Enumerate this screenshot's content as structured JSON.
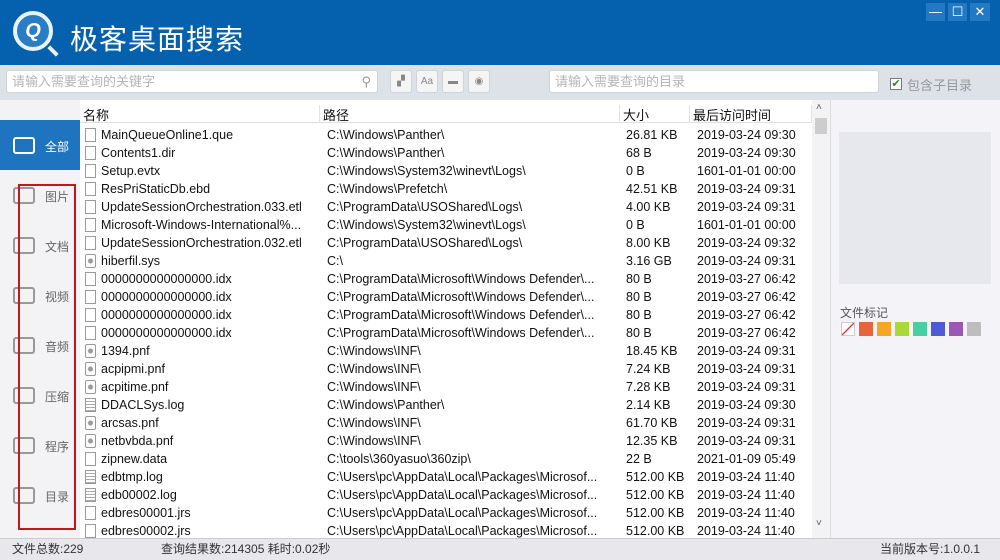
{
  "app": {
    "title": "极客桌面搜索",
    "logo_letter": "Q"
  },
  "window_controls": {
    "minimize": "—",
    "maximize": "☐",
    "close": "✕"
  },
  "toolbar": {
    "keyword_placeholder": "请输入需要查询的关键字",
    "dir_placeholder": "请输入需要查询的目录",
    "include_subdirs_label": "包含子目录",
    "include_subdirs_checked": true,
    "case_label": "Aa"
  },
  "sidebar": {
    "items": [
      {
        "label": "全部",
        "active": true
      },
      {
        "label": "图片"
      },
      {
        "label": "文档"
      },
      {
        "label": "视频"
      },
      {
        "label": "音频"
      },
      {
        "label": "压缩"
      },
      {
        "label": "程序"
      },
      {
        "label": "目录"
      }
    ]
  },
  "table": {
    "columns": [
      "名称",
      "路径",
      "大小",
      "最后访问时间"
    ],
    "rows": [
      {
        "name": "MainQueueOnline1.que",
        "path": "C:\\Windows\\Panther\\",
        "size": "26.81 KB",
        "time": "2019-03-24 09:30",
        "icon": "file"
      },
      {
        "name": "Contents1.dir",
        "path": "C:\\Windows\\Panther\\",
        "size": "68 B",
        "time": "2019-03-24 09:30",
        "icon": "file"
      },
      {
        "name": "Setup.evtx",
        "path": "C:\\Windows\\System32\\winevt\\Logs\\",
        "size": "0 B",
        "time": "1601-01-01 00:00",
        "icon": "file"
      },
      {
        "name": "ResPriStaticDb.ebd",
        "path": "C:\\Windows\\Prefetch\\",
        "size": "42.51 KB",
        "time": "2019-03-24 09:31",
        "icon": "file"
      },
      {
        "name": "UpdateSessionOrchestration.033.etl",
        "path": "C:\\ProgramData\\USOShared\\Logs\\",
        "size": "4.00 KB",
        "time": "2019-03-24 09:31",
        "icon": "file"
      },
      {
        "name": "Microsoft-Windows-International%...",
        "path": "C:\\Windows\\System32\\winevt\\Logs\\",
        "size": "0 B",
        "time": "1601-01-01 00:00",
        "icon": "file"
      },
      {
        "name": "UpdateSessionOrchestration.032.etl",
        "path": "C:\\ProgramData\\USOShared\\Logs\\",
        "size": "8.00 KB",
        "time": "2019-03-24 09:32",
        "icon": "file"
      },
      {
        "name": "hiberfil.sys",
        "path": "C:\\",
        "size": "3.16 GB",
        "time": "2019-03-24 09:31",
        "icon": "gear"
      },
      {
        "name": "0000000000000000.idx",
        "path": "C:\\ProgramData\\Microsoft\\Windows Defender\\...",
        "size": "80 B",
        "time": "2019-03-27 06:42",
        "icon": "file"
      },
      {
        "name": "0000000000000000.idx",
        "path": "C:\\ProgramData\\Microsoft\\Windows Defender\\...",
        "size": "80 B",
        "time": "2019-03-27 06:42",
        "icon": "file"
      },
      {
        "name": "0000000000000000.idx",
        "path": "C:\\ProgramData\\Microsoft\\Windows Defender\\...",
        "size": "80 B",
        "time": "2019-03-27 06:42",
        "icon": "file"
      },
      {
        "name": "0000000000000000.idx",
        "path": "C:\\ProgramData\\Microsoft\\Windows Defender\\...",
        "size": "80 B",
        "time": "2019-03-27 06:42",
        "icon": "file"
      },
      {
        "name": "1394.pnf",
        "path": "C:\\Windows\\INF\\",
        "size": "18.45 KB",
        "time": "2019-03-24 09:31",
        "icon": "gear"
      },
      {
        "name": "acpipmi.pnf",
        "path": "C:\\Windows\\INF\\",
        "size": "7.24 KB",
        "time": "2019-03-24 09:31",
        "icon": "gear"
      },
      {
        "name": "acpitime.pnf",
        "path": "C:\\Windows\\INF\\",
        "size": "7.28 KB",
        "time": "2019-03-24 09:31",
        "icon": "gear"
      },
      {
        "name": "DDACLSys.log",
        "path": "C:\\Windows\\Panther\\",
        "size": "2.14 KB",
        "time": "2019-03-24 09:30",
        "icon": "log"
      },
      {
        "name": "arcsas.pnf",
        "path": "C:\\Windows\\INF\\",
        "size": "61.70 KB",
        "time": "2019-03-24 09:31",
        "icon": "gear"
      },
      {
        "name": "netbvbda.pnf",
        "path": "C:\\Windows\\INF\\",
        "size": "12.35 KB",
        "time": "2019-03-24 09:31",
        "icon": "gear"
      },
      {
        "name": "zipnew.data",
        "path": "C:\\tools\\360yasuo\\360zip\\",
        "size": "22 B",
        "time": "2021-01-09 05:49",
        "icon": "file"
      },
      {
        "name": "edbtmp.log",
        "path": "C:\\Users\\pc\\AppData\\Local\\Packages\\Microsof...",
        "size": "512.00 KB",
        "time": "2019-03-24 11:40",
        "icon": "log"
      },
      {
        "name": "edb00002.log",
        "path": "C:\\Users\\pc\\AppData\\Local\\Packages\\Microsof...",
        "size": "512.00 KB",
        "time": "2019-03-24 11:40",
        "icon": "log"
      },
      {
        "name": "edbres00001.jrs",
        "path": "C:\\Users\\pc\\AppData\\Local\\Packages\\Microsof...",
        "size": "512.00 KB",
        "time": "2019-03-24 11:40",
        "icon": "file"
      },
      {
        "name": "edbres00002.jrs",
        "path": "C:\\Users\\pc\\AppData\\Local\\Packages\\Microsof...",
        "size": "512.00 KB",
        "time": "2019-03-24 11:40",
        "icon": "file"
      }
    ]
  },
  "right_panel": {
    "mark_label": "文件标记",
    "mark_colors": [
      "none",
      "#e8643c",
      "#f5a623",
      "#a8d83a",
      "#48cfa0",
      "#4f5bd5",
      "#9b59b6",
      "#bdbdbd"
    ]
  },
  "status": {
    "total_files": "文件总数:229",
    "result": "查询结果数:214305 耗时:0.02秒",
    "version": "当前版本号:1.0.0.1"
  }
}
